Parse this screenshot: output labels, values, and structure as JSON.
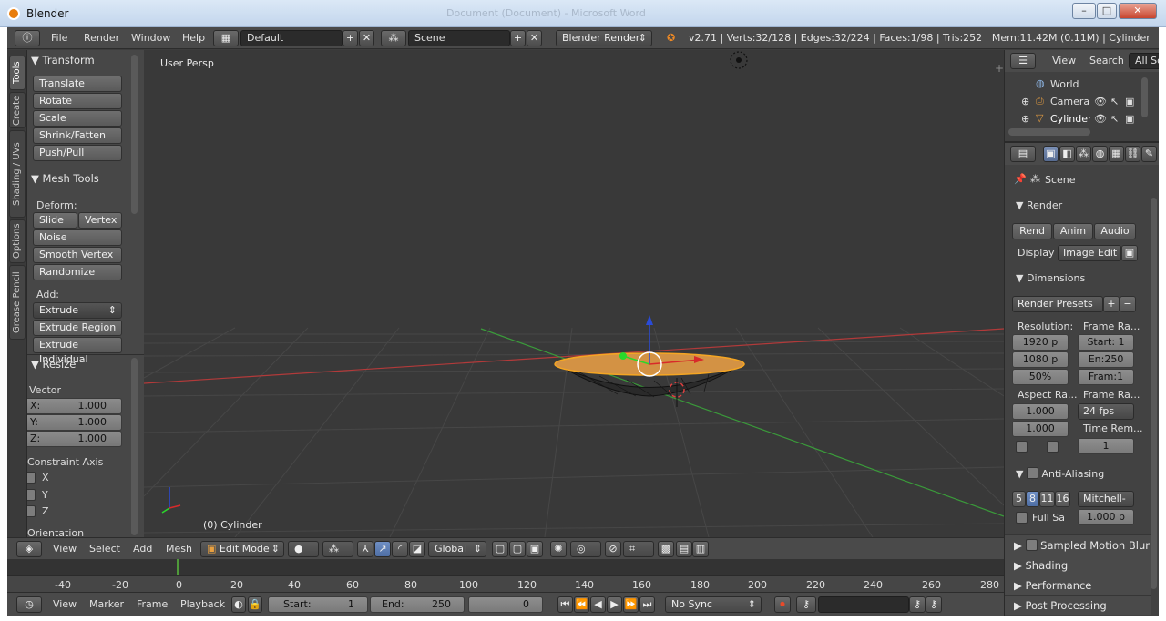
{
  "window": {
    "title": "Blender",
    "ghost_title": "Document (Document) - Microsoft Word",
    "minimize": "–",
    "maximize": "□",
    "close": "✕"
  },
  "menu": {
    "items": [
      "File",
      "Render",
      "Window",
      "Help"
    ],
    "layout": "Default",
    "scene": "Scene",
    "engine": "Blender Render",
    "stats": "v2.71 | Verts:32/128 | Edges:32/224 | Faces:1/98 | Tris:252 | Mem:11.42M (0.11M) | Cylinder"
  },
  "tool_tabs": [
    "Tools",
    "Create",
    "Shading / UVs",
    "Options",
    "Grease Pencil"
  ],
  "toolshelf": {
    "transform_header": "Transform",
    "transform_buttons": [
      "Translate",
      "Rotate",
      "Scale",
      "Shrink/Fatten",
      "Push/Pull"
    ],
    "mesh_tools_header": "Mesh Tools",
    "deform_label": "Deform:",
    "slide_edge": "Slide Ed",
    "vertex": "Vertex",
    "deform_buttons": [
      "Noise",
      "Smooth Vertex",
      "Randomize"
    ],
    "add_label": "Add:",
    "extrude": "Extrude",
    "add_buttons": [
      "Extrude Region",
      "Extrude Individual"
    ],
    "resize_header": "Resize",
    "vector_label": "Vector",
    "vector": [
      {
        "axis": "X:",
        "value": "1.000"
      },
      {
        "axis": "Y:",
        "value": "1.000"
      },
      {
        "axis": "Z:",
        "value": "1.000"
      }
    ],
    "constraint_label": "Constraint Axis",
    "constraints": [
      "X",
      "Y",
      "Z"
    ],
    "orientation_label": "Orientation"
  },
  "viewport": {
    "view_name": "User Persp",
    "object_label": "(0) Cylinder",
    "selection_color": "#f5a623"
  },
  "viewport_header": {
    "items": [
      "View",
      "Select",
      "Add",
      "Mesh"
    ],
    "mode": "Edit Mode",
    "orientation": "Global"
  },
  "timeline": {
    "ticks": [
      "-40",
      "-20",
      "0",
      "20",
      "40",
      "60",
      "80",
      "100",
      "120",
      "140",
      "160",
      "180",
      "200",
      "220",
      "240",
      "260",
      "280"
    ],
    "current_frame_marker": "0",
    "items": [
      "View",
      "Marker",
      "Frame",
      "Playback"
    ],
    "start_label": "Start:",
    "start_value": "1",
    "end_label": "End:",
    "end_value": "250",
    "current": "0",
    "sync": "No Sync"
  },
  "outliner": {
    "items": [
      "View",
      "Search"
    ],
    "filter": "All Sc",
    "tree": [
      "World",
      "Camera",
      "Cylinder"
    ]
  },
  "properties": {
    "context": "Scene",
    "render_header": "Render",
    "render_buttons": [
      "Rend",
      "Anim",
      "Audio"
    ],
    "display_label": "Display",
    "display_value": "Image Edit",
    "dimensions_header": "Dimensions",
    "render_presets": "Render Presets",
    "resolution_label": "Resolution:",
    "res_x": "1920 p",
    "res_y": "1080 p",
    "res_pct": "50%",
    "frame_range_label": "Frame Ra...",
    "frame_start": "Start: 1",
    "frame_end": "En:250",
    "frame_step": "Fram:1",
    "aspect_label": "Aspect Ra...",
    "aspect_x": "1.000",
    "aspect_y": "1.000",
    "frame_rate_label": "Frame Ra...",
    "fps": "24 fps",
    "time_remap_label": "Time Rem...",
    "time_remap_value": "1",
    "aa_header": "Anti-Aliasing",
    "aa_samples": [
      "5",
      "8",
      "11",
      "16"
    ],
    "aa_filter": "Mitchell-",
    "full_sample": "Full Sa",
    "filter_size": "1.000 p",
    "sections": [
      "Sampled Motion Blur",
      "Shading",
      "Performance",
      "Post Processing"
    ]
  }
}
